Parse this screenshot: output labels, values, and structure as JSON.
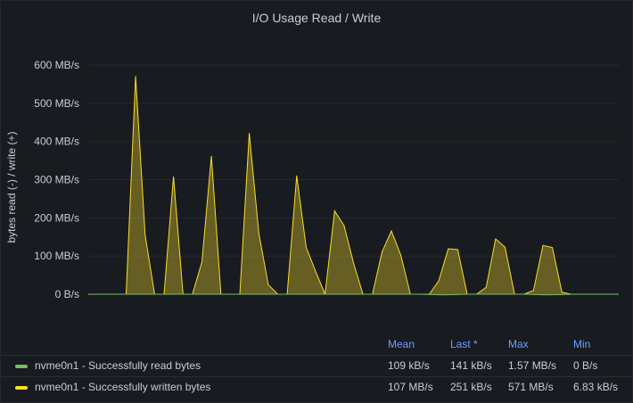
{
  "panel": {
    "title": "I/O Usage Read / Write"
  },
  "chart_data": {
    "type": "area",
    "ylabel": "bytes read (-) / write (+)",
    "ylim": [
      0,
      600
    ],
    "yticks": [
      "0 B/s",
      "100 MB/s",
      "200 MB/s",
      "300 MB/s",
      "400 MB/s",
      "500 MB/s",
      "600 MB/s"
    ],
    "ytick_values": [
      0,
      100,
      200,
      300,
      400,
      500,
      600
    ],
    "x_index": [
      0,
      1,
      2,
      3,
      4,
      5,
      6,
      7,
      8,
      9,
      10,
      11,
      12,
      13,
      14,
      15,
      16,
      17,
      18,
      19,
      20,
      21,
      22,
      23,
      24,
      25,
      26,
      27,
      28,
      29,
      30,
      31,
      32,
      33,
      34,
      35,
      36,
      37,
      38,
      39,
      40,
      41,
      42,
      43,
      44,
      45,
      46,
      47,
      48,
      49,
      50,
      51,
      52,
      53,
      54,
      55,
      56
    ],
    "series": [
      {
        "name": "nvme0n1 - Successfully written bytes",
        "color": "#fade2a",
        "values": [
          0,
          0,
          0,
          0,
          0,
          571,
          155,
          0,
          0,
          308,
          0,
          0,
          85,
          362,
          0,
          0,
          0,
          422,
          160,
          25,
          0,
          0,
          311,
          123,
          60,
          0,
          218,
          180,
          82,
          0,
          0,
          110,
          166,
          102,
          0,
          0,
          0,
          35,
          119,
          117,
          0,
          0,
          18,
          145,
          123,
          0,
          0,
          10,
          128,
          122,
          5,
          0,
          0,
          0,
          0,
          0,
          0
        ]
      },
      {
        "name": "nvme0n1 - Successfully read bytes",
        "color": "#73bf69",
        "values": [
          0,
          0,
          0,
          0,
          0,
          0,
          0,
          0,
          0,
          0,
          0,
          0,
          0,
          0,
          0,
          0,
          0,
          0,
          0,
          0,
          0,
          0,
          0,
          0,
          0,
          0,
          0,
          0,
          0,
          0,
          0,
          0,
          0,
          0,
          0,
          0,
          -0.5,
          -1.5,
          -1.5,
          -1,
          0,
          0,
          0,
          0,
          0,
          0,
          0,
          -0.5,
          -1.5,
          -1.5,
          -1,
          0,
          0,
          0,
          0,
          0,
          0
        ]
      }
    ],
    "grid": true
  },
  "legend": {
    "headers": {
      "mean": "Mean",
      "last": "Last *",
      "max": "Max",
      "min": "Min"
    },
    "rows": [
      {
        "name": "nvme0n1 - Successfully read bytes",
        "color": "#73bf69",
        "mean": "109 kB/s",
        "last": "141 kB/s",
        "max": "1.57 MB/s",
        "min": "0 B/s"
      },
      {
        "name": "nvme0n1 - Successfully written bytes",
        "color": "#fade2a",
        "mean": "107 MB/s",
        "last": "251 kB/s",
        "max": "571 MB/s",
        "min": "6.83 kB/s"
      }
    ]
  }
}
